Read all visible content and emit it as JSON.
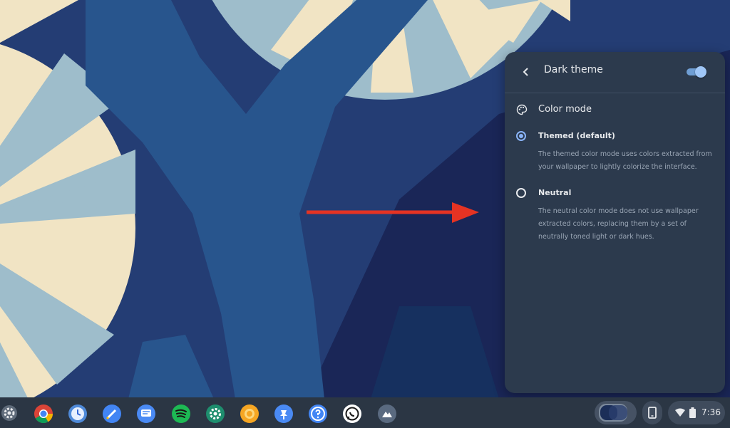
{
  "settings_panel": {
    "title": "Dark theme",
    "toggle_on": true,
    "section_title": "Color mode",
    "options": [
      {
        "label": "Themed (default)",
        "description": "The themed color mode uses colors extracted from your wallpaper to lightly colorize the interface.",
        "selected": true
      },
      {
        "label": "Neutral",
        "description": "The neutral color mode does not use wallpaper extracted colors, replacing them by a set of neutrally toned light or dark hues.",
        "selected": false
      }
    ]
  },
  "shelf": {
    "apps": [
      {
        "icon": "settings-gear-icon",
        "color": "#5f6b7a"
      },
      {
        "icon": "chrome-icon",
        "color": "#4285f4"
      },
      {
        "icon": "clock-icon",
        "color": "#4f8ad9"
      },
      {
        "icon": "tasks-pen-icon",
        "color": "#4285f4"
      },
      {
        "icon": "messages-icon",
        "color": "#4a8af4"
      },
      {
        "icon": "spotify-icon",
        "color": "#1db954"
      },
      {
        "icon": "settings-app-icon",
        "color": "#1e8e6e"
      },
      {
        "icon": "photos-lens-icon",
        "color": "#f6a623"
      },
      {
        "icon": "pinning-pin-icon",
        "color": "#4a8af4"
      },
      {
        "icon": "help-icon",
        "color": "#4285f4"
      },
      {
        "icon": "whatsapp-icon",
        "color": "#ffffff"
      },
      {
        "icon": "gallery-icon",
        "color": "#5a6a80"
      }
    ],
    "status": {
      "time": "7:36"
    }
  },
  "colors": {
    "accent": "#8ab4f8",
    "panel_bg": "#2c3a4d",
    "arrow": "#e53323"
  }
}
